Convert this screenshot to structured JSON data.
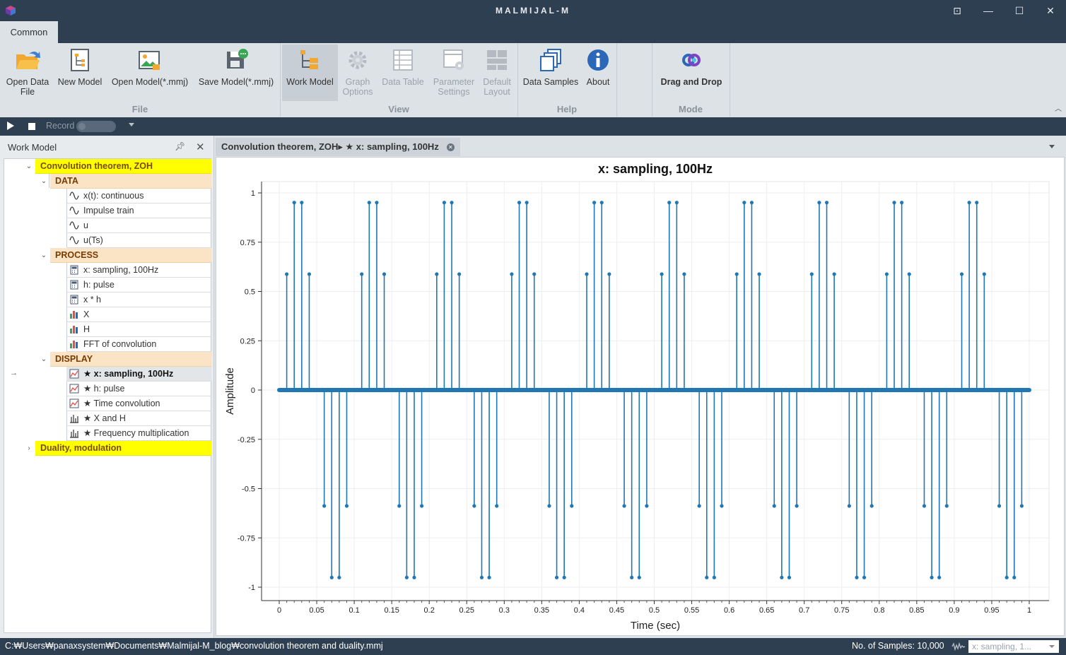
{
  "window": {
    "title": "MALMIJAL-M",
    "app_icon": "cube-icon",
    "controls": [
      "restore-layout-icon",
      "minimize-icon",
      "maximize-icon",
      "close-icon"
    ]
  },
  "ribbon": {
    "tab": "Common",
    "buttons": {
      "open_data_file": [
        "Open Data",
        "File"
      ],
      "new_model": "New Model",
      "open_model": "Open Model(*.mmj)",
      "save_model": "Save Model(*.mmj)",
      "work_model": "Work Model",
      "graph_options": [
        "Graph",
        "Options"
      ],
      "data_table": "Data Table",
      "parameter_settings": [
        "Parameter",
        "Settings"
      ],
      "default_layout": [
        "Default",
        "Layout"
      ],
      "data_samples": "Data Samples",
      "about": "About",
      "drag_and_drop": "Drag and Drop"
    },
    "groups": {
      "file": "File",
      "view": "View",
      "help": "Help",
      "mode": "Mode"
    }
  },
  "record_bar": {
    "record_label": "Record"
  },
  "work_model": {
    "title": "Work Model",
    "tree": {
      "group1": "Convolution theorem, ZOH",
      "data_label": "DATA",
      "data_items": [
        "x(t): continuous",
        "Impulse train",
        "u",
        "u(Ts)"
      ],
      "process_label": "PROCESS",
      "process_items": [
        "x: sampling, 100Hz",
        "h: pulse",
        "x * h",
        "X",
        "H",
        "FFT of convolution"
      ],
      "display_label": "DISPLAY",
      "display_items": [
        "★ x: sampling, 100Hz",
        "★ h: pulse",
        "★ Time convolution",
        "★ X and H",
        "★ Frequency multiplication"
      ],
      "group2": "Duality, modulation"
    }
  },
  "document": {
    "tab_title": "Convolution theorem, ZOH▸ ★ x: sampling, 100Hz"
  },
  "chart_data": {
    "type": "stem",
    "title": "x: sampling, 100Hz",
    "xlabel": "Time (sec)",
    "ylabel": "Amplitude",
    "xlim": [
      0,
      1
    ],
    "ylim": [
      -1,
      1
    ],
    "x_ticks": [
      "0",
      "0.05",
      "0.1",
      "0.15",
      "0.2",
      "0.25",
      "0.3",
      "0.35",
      "0.4",
      "0.45",
      "0.5",
      "0.55",
      "0.6",
      "0.65",
      "0.7",
      "0.75",
      "0.8",
      "0.85",
      "0.9",
      "0.95",
      "1"
    ],
    "y_ticks": [
      "1",
      "0.75",
      "0.5",
      "0.25",
      "0",
      "-0.25",
      "-0.5",
      "-0.75",
      "-1"
    ],
    "grid": true,
    "color": "#1f77b4",
    "sample_interval": 0.01,
    "period": 0.1,
    "period_values": [
      0,
      0.588,
      0.951,
      0.951,
      0.588,
      0,
      -0.588,
      -0.951,
      -0.951,
      -0.588
    ],
    "continuous_baseline_points": 10000
  },
  "status": {
    "path": "C:₩Users₩panaxsystem₩Documents₩Malmijal-M_blog₩convolution theorem and duality.mmj",
    "samples": "No. of Samples: 10,000",
    "combo": "x: sampling, 1..."
  }
}
